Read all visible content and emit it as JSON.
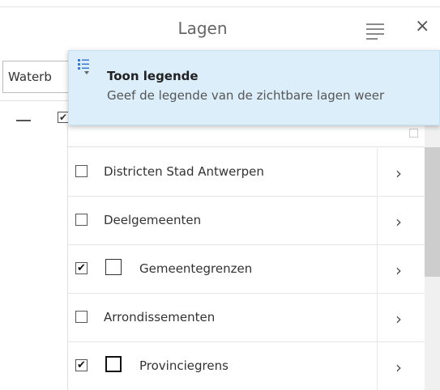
{
  "panel": {
    "title": "Lagen",
    "menu_icon": "hamburger-menu-icon",
    "close_icon": "close-icon",
    "close_glyph": "×"
  },
  "toolbar": {
    "select_value": "Waterb"
  },
  "tooltip": {
    "icon": "legend-list-icon",
    "title": "Toon legende",
    "text": "Geef de legende van de zichtbare lagen weer"
  },
  "layers": [
    {
      "label": "Districten Stad Antwerpen",
      "checked": false,
      "legend": "none"
    },
    {
      "label": "Deelgemeenten",
      "checked": false,
      "legend": "none"
    },
    {
      "label": "Gemeentegrenzen",
      "checked": true,
      "legend": "thin-box"
    },
    {
      "label": "Arrondissementen",
      "checked": false,
      "legend": "none"
    },
    {
      "label": "Provinciegrens",
      "checked": true,
      "legend": "thick-box"
    }
  ],
  "chevron_glyph": "›",
  "check_glyph": "✔",
  "colors": {
    "tooltip_bg": "#dbeefa",
    "scroll_thumb": "#cdcdcd"
  }
}
